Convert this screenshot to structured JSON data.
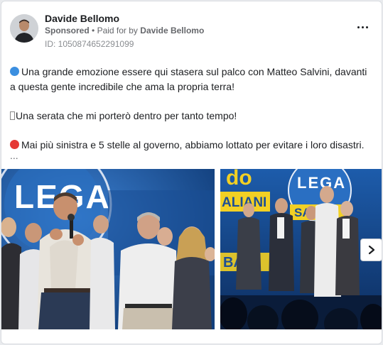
{
  "header": {
    "advertiser_name": "Davide Bellomo",
    "sponsored_label": "Sponsored",
    "separator": "•",
    "paid_for_prefix": "Paid for by",
    "paid_for_name": "Davide Bellomo",
    "id_text": "ID: 1050874652291099",
    "more_icon": "more-horizontal-icon"
  },
  "post": {
    "line1": "Una grande emozione essere qui stasera sul palco con Matteo Salvini, davanti a questa gente incredibile che ama la propria terra!",
    "line2": "Una serata che mi porterò dentro per tanto tempo!",
    "line3": "Mai più sinistra e 5 stelle al governo, abbiamo lottato per evitare i loro disastri.",
    "truncation": "...",
    "emoji_blue": "blue-circle-icon",
    "emoji_red": "red-circle-icon"
  },
  "media": {
    "carousel": [
      {
        "name": "photo-1",
        "sign_text": "LEGA"
      },
      {
        "name": "photo-2",
        "sign_text_top": "do",
        "sign_text_left": "ALIANI",
        "sign_text_lega": "LEGA",
        "sign_text_salvini": "SALVI",
        "sign_text_bottom": "BA"
      }
    ],
    "next_icon": "chevron-right-icon"
  },
  "colors": {
    "stage_blue": "#1e5fa8",
    "lega_yellow": "#f2d024",
    "text_primary": "#1c1e21",
    "text_secondary": "#65676b"
  }
}
